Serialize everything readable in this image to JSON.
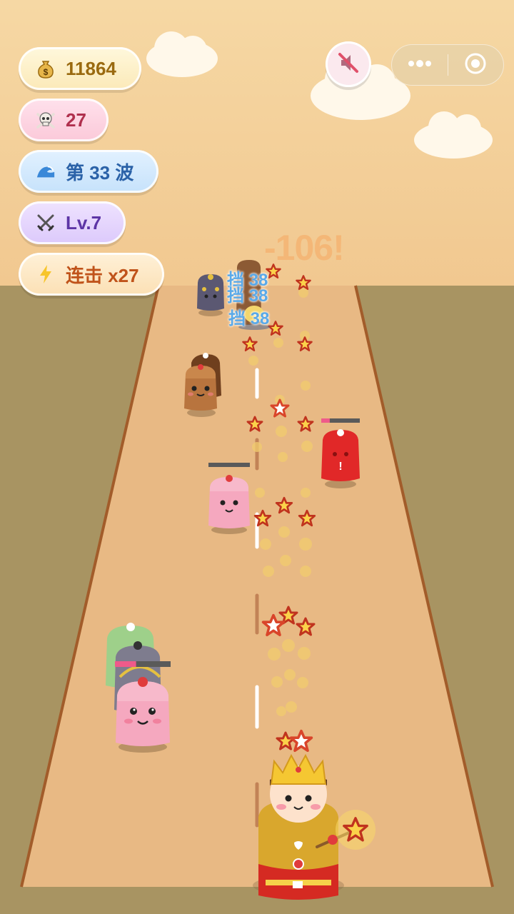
{
  "hud": {
    "coins": {
      "icon": "money-bag-icon",
      "value": "11864"
    },
    "kills": {
      "icon": "skull-icon",
      "value": "27"
    },
    "wave": {
      "icon": "wave-icon",
      "value": "第 33 波"
    },
    "level": {
      "icon": "crossed-swords-icon",
      "value": "Lv.7"
    },
    "combo": {
      "icon": "lightning-icon",
      "value": "连击 x27"
    }
  },
  "top_controls": {
    "mute_button": {
      "icon": "speaker-muted-icon",
      "state": "muted"
    },
    "capsule": {
      "more_icon": "more-dots-icon",
      "close_icon": "target-circle-icon"
    }
  },
  "battle": {
    "damage_popup": "-106!",
    "block_popups": [
      "挡 38",
      "挡 38",
      "挡 38"
    ],
    "enemy_health": {
      "pink_small": 0.0,
      "red": 0.22,
      "pink_big": 0.38
    }
  },
  "colors": {
    "sky": "#f3cf94",
    "road": "#e8b984",
    "ground": "#a89462",
    "accent_gold": "#d9a72d"
  }
}
